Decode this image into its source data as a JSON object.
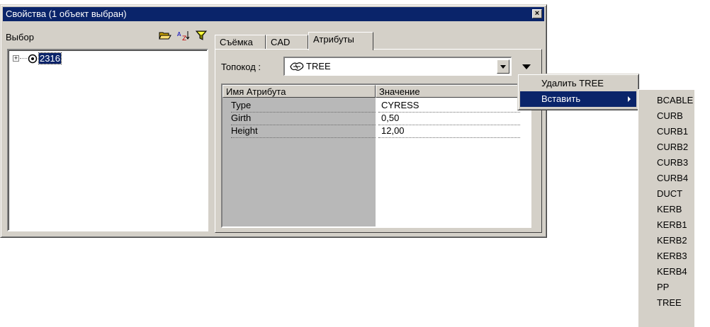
{
  "window": {
    "title": "Свойства (1 объект выбран)",
    "close_glyph": "×"
  },
  "left_pane": {
    "label": "Выбор",
    "toolbar_icons": [
      "folder-open-icon",
      "sort-az-icon",
      "filter-icon"
    ],
    "tree": {
      "expander": "+",
      "node_label": "2316"
    }
  },
  "tabs": [
    {
      "label": "Съёмка",
      "active": false
    },
    {
      "label": "CAD",
      "active": false
    },
    {
      "label": "Атрибуты",
      "active": true
    }
  ],
  "topocode": {
    "label": "Топокод :",
    "value": "TREE",
    "icon": "tree-symbol-icon"
  },
  "grid": {
    "headers": [
      "Имя Атрибута",
      "Значение"
    ],
    "rows": [
      {
        "name": "Type",
        "value": "CYRESS"
      },
      {
        "name": "Girth",
        "value": "0,50"
      },
      {
        "name": "Height",
        "value": "12,00"
      }
    ]
  },
  "context_menu": {
    "items": [
      {
        "label": "Удалить TREE",
        "highlighted": false
      },
      {
        "label": "Вставить",
        "highlighted": true,
        "has_submenu": true
      }
    ]
  },
  "submenu": {
    "items": [
      "BCABLE",
      "CURB",
      "CURB1",
      "CURB2",
      "CURB3",
      "CURB4",
      "DUCT",
      "KERB",
      "KERB1",
      "KERB2",
      "KERB3",
      "KERB4",
      "PP",
      "TREE"
    ]
  },
  "colors": {
    "titlebar": "#0a246a",
    "face": "#d4d0c8",
    "grid_bg": "#b8b8b8",
    "highlight": "#0a246a"
  }
}
